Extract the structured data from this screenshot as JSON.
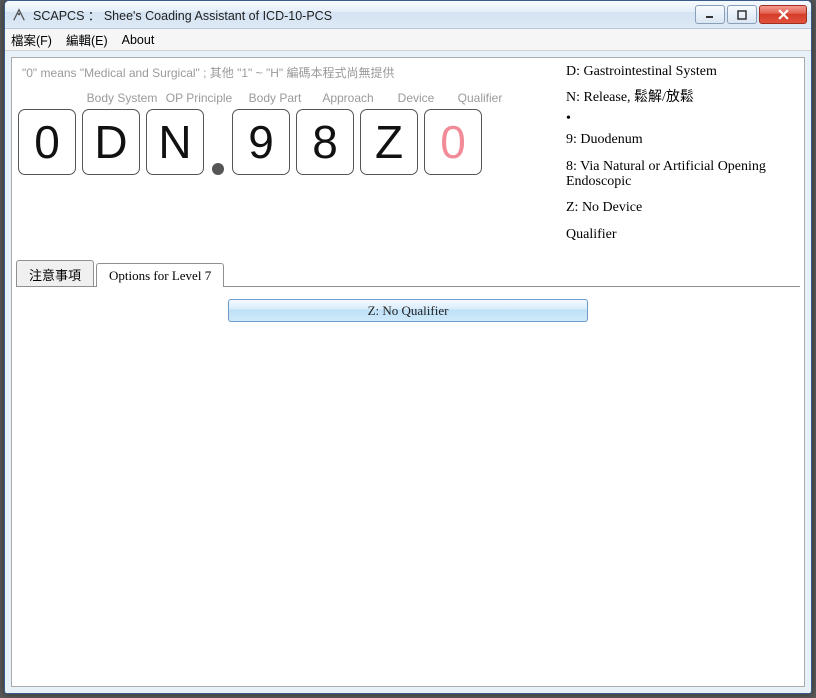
{
  "window": {
    "title": "SCAPCS ： Shee's Coading Assistant of ICD-10-PCS"
  },
  "menu": {
    "file": "檔案(F)",
    "edit": "編輯(E)",
    "about": "About"
  },
  "hint": "\"0\" means \"Medical and Surgical\" ;   其他 \"1\" ~ \"H\" 編碼本程式尚無提供",
  "axis_labels": {
    "body_system": "Body System",
    "op_principle": "OP Principle",
    "body_part": "Body Part",
    "approach": "Approach",
    "device": "Device",
    "qualifier": "Qualifier"
  },
  "code": {
    "c1": "0",
    "c2": "D",
    "c3": "N",
    "c4": "9",
    "c5": "8",
    "c6": "Z",
    "c7": "0"
  },
  "desc": {
    "d": "D: Gastrointestinal System",
    "n": "N: Release, 鬆解/放鬆",
    "dot": "•",
    "nine": "9: Duodenum",
    "eight": "8: Via Natural or Artificial Opening Endoscopic",
    "z": "Z: No Device",
    "qual": "Qualifier"
  },
  "tabs": {
    "notes": "注意事項",
    "options": "Options for Level 7"
  },
  "option": {
    "z": "Z: No Qualifier"
  }
}
